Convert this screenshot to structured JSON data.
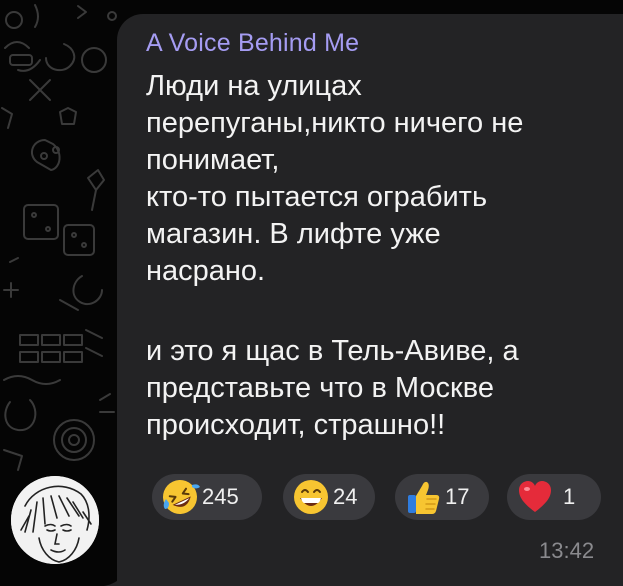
{
  "message": {
    "sender": "A Voice Behind Me",
    "lines": [
      "Люди на улицах",
      "перепуганы,никто ничего не",
      "понимает,",
      "кто-то пытается ограбить",
      "магазин. В лифте уже",
      "насрано."
    ],
    "lines_after_break": [
      "и это я щас в Тель-Авиве, а",
      "представьте что в Москве",
      "происходит, страшно!!"
    ],
    "time": "13:42"
  },
  "reactions": [
    {
      "emoji": "rolling-on-floor-laughing",
      "count": "245"
    },
    {
      "emoji": "grinning-face",
      "count": "24"
    },
    {
      "emoji": "thumbs-up",
      "count": "17"
    },
    {
      "emoji": "red-heart",
      "count": "1"
    }
  ],
  "colors": {
    "background": "#050505",
    "bubble": "#232325",
    "sender_name": "#a59cf2",
    "text": "#f3f3f3",
    "reaction_pill": "#3a3a3e",
    "timestamp": "#8a8a8e"
  }
}
